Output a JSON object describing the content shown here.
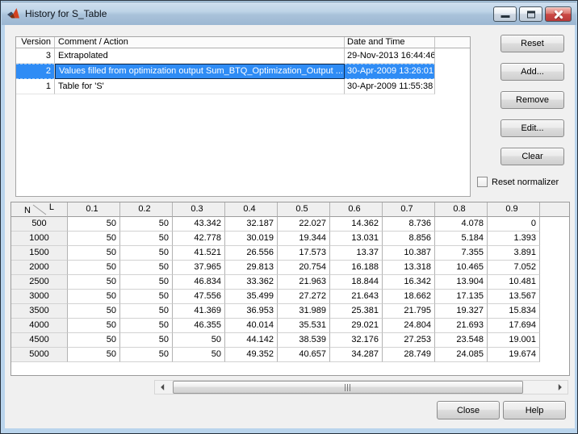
{
  "window": {
    "title": "History for S_Table"
  },
  "titlebar": {
    "minimize_icon": "minimize",
    "maximize_icon": "maximize",
    "close_icon": "close"
  },
  "history": {
    "columns": {
      "version": "Version",
      "comment": "Comment / Action",
      "date": "Date and Time"
    },
    "rows": [
      {
        "version": "3",
        "comment": "Extrapolated",
        "date": "29-Nov-2013 16:44:46",
        "selected": false
      },
      {
        "version": "2",
        "comment": "Values filled from optimization output Sum_BTQ_Optimization_Output ...",
        "date": "30-Apr-2009 13:26:01",
        "selected": true
      },
      {
        "version": "1",
        "comment": "Table for 'S'",
        "date": "30-Apr-2009 11:55:38",
        "selected": false
      }
    ]
  },
  "actions": {
    "reset": "Reset",
    "add": "Add...",
    "remove": "Remove",
    "edit": "Edit...",
    "clear": "Clear"
  },
  "reset_normalizer": {
    "label": "Reset normalizer",
    "checked": false
  },
  "data_table": {
    "corner": {
      "row_label": "N",
      "col_label": "L"
    },
    "col_headers": [
      "0.1",
      "0.2",
      "0.3",
      "0.4",
      "0.5",
      "0.6",
      "0.7",
      "0.8",
      "0.9"
    ],
    "rows": [
      {
        "n": "500",
        "values": [
          "50",
          "50",
          "43.342",
          "32.187",
          "22.027",
          "14.362",
          "8.736",
          "4.078",
          "0"
        ]
      },
      {
        "n": "1000",
        "values": [
          "50",
          "50",
          "42.778",
          "30.019",
          "19.344",
          "13.031",
          "8.856",
          "5.184",
          "1.393"
        ]
      },
      {
        "n": "1500",
        "values": [
          "50",
          "50",
          "41.521",
          "26.556",
          "17.573",
          "13.37",
          "10.387",
          "7.355",
          "3.891"
        ]
      },
      {
        "n": "2000",
        "values": [
          "50",
          "50",
          "37.965",
          "29.813",
          "20.754",
          "16.188",
          "13.318",
          "10.465",
          "7.052"
        ]
      },
      {
        "n": "2500",
        "values": [
          "50",
          "50",
          "46.834",
          "33.362",
          "21.963",
          "18.844",
          "16.342",
          "13.904",
          "10.481"
        ]
      },
      {
        "n": "3000",
        "values": [
          "50",
          "50",
          "47.556",
          "35.499",
          "27.272",
          "21.643",
          "18.662",
          "17.135",
          "13.567"
        ]
      },
      {
        "n": "3500",
        "values": [
          "50",
          "50",
          "41.369",
          "36.953",
          "31.989",
          "25.381",
          "21.795",
          "19.327",
          "15.834"
        ]
      },
      {
        "n": "4000",
        "values": [
          "50",
          "50",
          "46.355",
          "40.014",
          "35.531",
          "29.021",
          "24.804",
          "21.693",
          "17.694"
        ]
      },
      {
        "n": "4500",
        "values": [
          "50",
          "50",
          "50",
          "44.142",
          "38.539",
          "32.176",
          "27.253",
          "23.548",
          "19.001"
        ]
      },
      {
        "n": "5000",
        "values": [
          "50",
          "50",
          "50",
          "49.352",
          "40.657",
          "34.287",
          "28.749",
          "24.085",
          "19.674"
        ]
      }
    ]
  },
  "footer": {
    "close": "Close",
    "help": "Help"
  },
  "colors": {
    "selection_blue": "#2f8cf5",
    "close_button_red": "#cb4946",
    "frame_blue": "#b9d4ec",
    "dialog_gray": "#f0f0f0"
  }
}
